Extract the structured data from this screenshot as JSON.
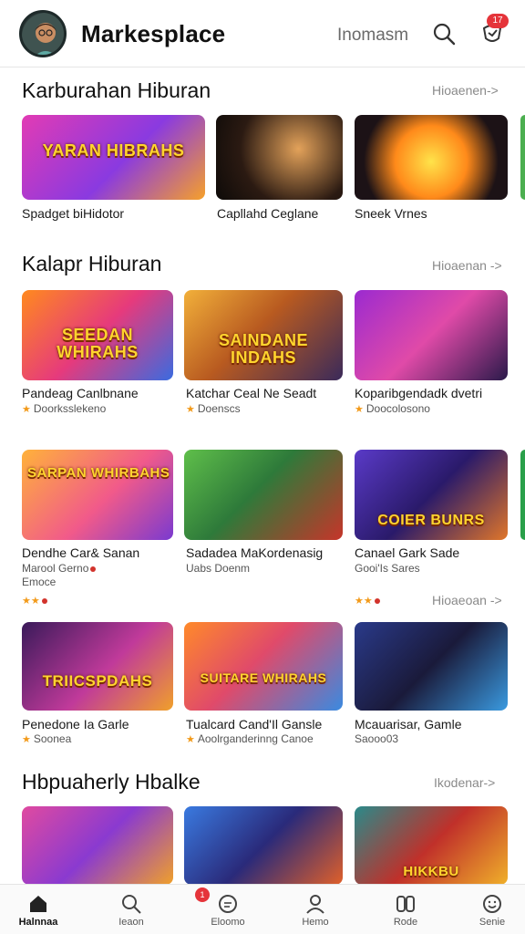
{
  "header": {
    "title": "Markesplace",
    "link_label": "Inomasm",
    "notif_count": "17",
    "icons": {
      "avatar": "avatar",
      "search": "search-icon",
      "notification": "bell-icon"
    }
  },
  "sections": [
    {
      "title": "Karburahan Hiburan",
      "more": "Hioaenen->",
      "cards": [
        {
          "title": "Spadget biHidotor",
          "thumb_text": "YARAN HIBRAHS"
        },
        {
          "title": "Capllahd Ceglane",
          "thumb_text": ""
        },
        {
          "title": "Sneek Vrnes",
          "thumb_text": ""
        }
      ]
    },
    {
      "title": "Kalapr Hiburan",
      "more": "Hioaenan ->",
      "cards": [
        {
          "title": "Pandeag Canlbnane",
          "sub": "Doorksslekeno",
          "thumb_text": "SEEDAN WHIRAHS"
        },
        {
          "title": "Katchar Ceal Ne Seadt",
          "sub": "Doenscs",
          "thumb_text": "SAINDANE INDAHS"
        },
        {
          "title": "Koparibgendadk dvetri",
          "sub": "Doocolosono",
          "thumb_text": ""
        }
      ]
    },
    {
      "title": "",
      "more": "Hioaeoan ->",
      "cards": [
        {
          "title": "Dendhe Car& Sanan",
          "sub": "Marool Gerno",
          "sub2": "Emoce",
          "thumb_text": "SARPAN WHIRBAHS"
        },
        {
          "title": "Sadadea MaKordenasig",
          "sub": "Uabs Doenm",
          "thumb_text": ""
        },
        {
          "title": "Canael Gark Sade",
          "sub": "Gooi'Is Sares",
          "thumb_text": "COIER BUNRS"
        }
      ]
    },
    {
      "title": "",
      "more": "",
      "cards": [
        {
          "title": "Penedone Ia Garle",
          "sub": "Soonea",
          "thumb_text": "TRIICSPDAHS"
        },
        {
          "title": "Tualcard Cand'Il Gansle",
          "sub": "Aoolrganderinng Canoe",
          "thumb_text": "SUITARE WHIRAHS"
        },
        {
          "title": "Mcauarisar, Gamle",
          "sub": "Saooo03",
          "thumb_text": ""
        }
      ]
    },
    {
      "title": "Hbpuaherly Hbalke",
      "more": "Ikodenar->",
      "cards": [
        {
          "title": "",
          "thumb_text": ""
        },
        {
          "title": "",
          "thumb_text": ""
        },
        {
          "title": "",
          "thumb_text": "HIKKBU"
        }
      ]
    }
  ],
  "bottom_nav": [
    {
      "label": "Halnnaa",
      "icon": "home-icon",
      "active": true
    },
    {
      "label": "Ieaon",
      "icon": "search-icon"
    },
    {
      "label": "Eloomo",
      "icon": "chat-icon",
      "badge": "1"
    },
    {
      "label": "Hemo",
      "icon": "profile-icon"
    },
    {
      "label": "Rode",
      "icon": "bookmark-icon"
    },
    {
      "label": "Senie",
      "icon": "smile-icon"
    }
  ],
  "colors": {
    "accent": "#e5343a",
    "star": "#f29a1a",
    "text": "#111111",
    "muted": "#8a8a8a"
  }
}
